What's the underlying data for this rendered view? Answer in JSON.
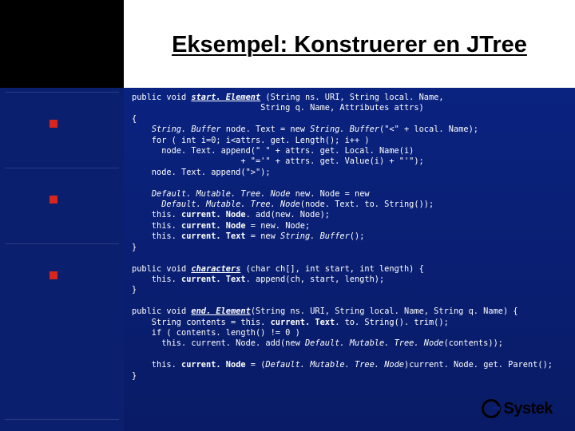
{
  "title": "Eksempel: Konstruerer en JTree",
  "logo": "Systek",
  "bullets": [
    150,
    245,
    340
  ],
  "hlines": [
    115,
    210,
    305,
    525
  ],
  "code": {
    "l01a": "public void ",
    "l01b": "start. Element",
    "l01c": " (String ns. URI, String local. Name,",
    "l02": "                          String q. Name, Attributes attrs)",
    "l03": "{",
    "l04a": "    ",
    "l04b": "String. Buffer",
    "l04c": " node. Text = new ",
    "l04d": "String. Buffer",
    "l04e": "(\"<\" + local. Name);",
    "l05": "    for ( int i=0; i<attrs. get. Length(); i++ )",
    "l06": "      node. Text. append(\" \" + attrs. get. Local. Name(i)",
    "l07": "                      + \"='\" + attrs. get. Value(i) + \"'\");",
    "l08": "    node. Text. append(\">\");",
    "l09": "",
    "l10a": "    ",
    "l10b": "Default. Mutable. Tree. Node",
    "l10c": " new. Node = new",
    "l11a": "      ",
    "l11b": "Default. Mutable. Tree. Node",
    "l11c": "(node. Text. to. String());",
    "l12a": "    this. ",
    "l12b": "current. Node",
    "l12c": ". add(new. Node);",
    "l13a": "    this. ",
    "l13b": "current. Node",
    "l13c": " = new. Node;",
    "l14a": "    this. ",
    "l14b": "current. Text",
    "l14c": " = new ",
    "l14d": "String. Buffer",
    "l14e": "();",
    "l15": "}",
    "l16": "",
    "l17a": "public void ",
    "l17b": "characters",
    "l17c": " (char ch[], int start, int length) {",
    "l18a": "    this. ",
    "l18b": "current. Text",
    "l18c": ". append(ch, start, length);",
    "l19": "}",
    "l20": "",
    "l21a": "public void ",
    "l21b": "end. Element",
    "l21c": "(String ns. URI, String local. Name, String q. Name) {",
    "l22a": "    String contents = this. ",
    "l22b": "current. Text",
    "l22c": ". to. String(). trim();",
    "l23": "    if ( contents. length() != 0 )",
    "l24a": "      this. current. Node. add(new ",
    "l24b": "Default. Mutable. Tree. Node",
    "l24c": "(contents));",
    "l25": "",
    "l26a": "    this. ",
    "l26b": "current. Node",
    "l26c": " = (",
    "l26d": "Default. Mutable. Tree. Node",
    "l26e": ")current. Node. get. Parent();",
    "l27": "}"
  }
}
